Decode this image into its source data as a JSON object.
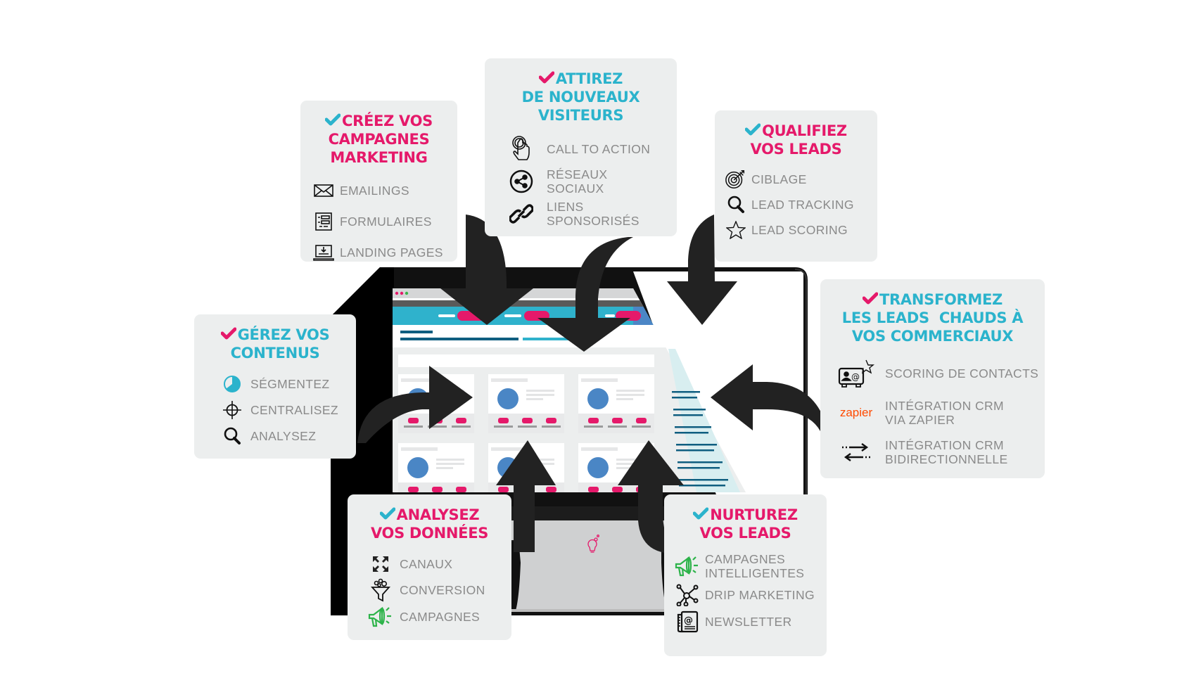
{
  "colors": {
    "pink": "#e5196a",
    "teal": "#2bb3cc",
    "box_bg": "#eceeee",
    "item_text": "#8a8a8a",
    "arrow": "#222222",
    "monitor": "#111111",
    "browser_bar": "#2fb2cc",
    "browser_bar_right": "#4b86c6",
    "avatar_blue": "#4a86c5",
    "zapier_orange": "#ff4a00",
    "megaphone_green": "#2db34a"
  },
  "boxes": {
    "creez": {
      "title_lines": [
        "CRÉEZ VOS",
        "CAMPAGNES",
        "MARKETING"
      ],
      "title_color": "pink",
      "check_color": "teal",
      "items": [
        {
          "icon": "envelope-icon",
          "label": "EMAILINGS"
        },
        {
          "icon": "form-icon",
          "label": "FORMULAIRES"
        },
        {
          "icon": "laptop-download-icon",
          "label": "LANDING PAGES"
        }
      ]
    },
    "attirez": {
      "title_lines": [
        "ATTIREZ",
        "DE NOUVEAUX",
        "VISITEURS"
      ],
      "title_color": "teal",
      "check_color": "pink",
      "items": [
        {
          "icon": "touch-hand-icon",
          "label": "CALL TO ACTION"
        },
        {
          "icon": "share-icon",
          "label": "RÉSEAUX\nSOCIAUX"
        },
        {
          "icon": "link-icon",
          "label": "LIENS\nSPONSORISÉS"
        }
      ]
    },
    "qualifiez": {
      "title_lines": [
        "QUALIFIEZ",
        "VOS LEADS"
      ],
      "title_color": "pink",
      "check_color": "teal",
      "items": [
        {
          "icon": "target-icon",
          "label": "CIBLAGE"
        },
        {
          "icon": "magnifier-icon",
          "label": "LEAD TRACKING"
        },
        {
          "icon": "star-icon",
          "label": "LEAD SCORING"
        }
      ]
    },
    "transformez": {
      "title_lines": [
        "TRANSFORMEZ",
        "LES LEADS  CHAUDS À",
        "VOS COMMERCIAUX"
      ],
      "title_color": "teal",
      "check_color": "pink",
      "items": [
        {
          "icon": "contact-card-star-icon",
          "label": "SCORING DE CONTACTS"
        },
        {
          "icon": "zapier-logo-icon",
          "icon_text": "zapier",
          "label": "INTÉGRATION CRM\nVIA ZAPIER"
        },
        {
          "icon": "bidirectional-arrows-icon",
          "label": "INTÉGRATION CRM\nBIDIRECTIONNELLE"
        }
      ]
    },
    "gerez": {
      "title_lines": [
        "GÉREZ VOS",
        "CONTENUS"
      ],
      "title_color": "teal",
      "check_color": "pink",
      "items": [
        {
          "icon": "pie-segment-icon",
          "label": "SÉGMENTEZ"
        },
        {
          "icon": "crosshair-icon",
          "label": "CENTRALISEZ"
        },
        {
          "icon": "magnifier-icon",
          "label": "ANALYSEZ"
        }
      ]
    },
    "analysez": {
      "title_lines": [
        "ANALYSEZ",
        "VOS DONNÉES"
      ],
      "title_color": "pink",
      "check_color": "teal",
      "items": [
        {
          "icon": "expand-arrows-icon",
          "label": "CANAUX"
        },
        {
          "icon": "funnel-icon",
          "label": "CONVERSION"
        },
        {
          "icon": "megaphone-icon",
          "label": "CAMPAGNES"
        }
      ]
    },
    "nurturez": {
      "title_lines": [
        "NURTUREZ",
        "VOS LEADS"
      ],
      "title_color": "pink",
      "check_color": "teal",
      "items": [
        {
          "icon": "megaphone-icon",
          "label": "CAMPAGNES\nINTELLIGENTES"
        },
        {
          "icon": "network-nodes-icon",
          "label": "DRIP MARKETING"
        },
        {
          "icon": "newsletter-at-icon",
          "label": "NEWSLETTER"
        }
      ]
    }
  },
  "monitor": {
    "logo_icon": "lightbulb-logo-icon"
  }
}
